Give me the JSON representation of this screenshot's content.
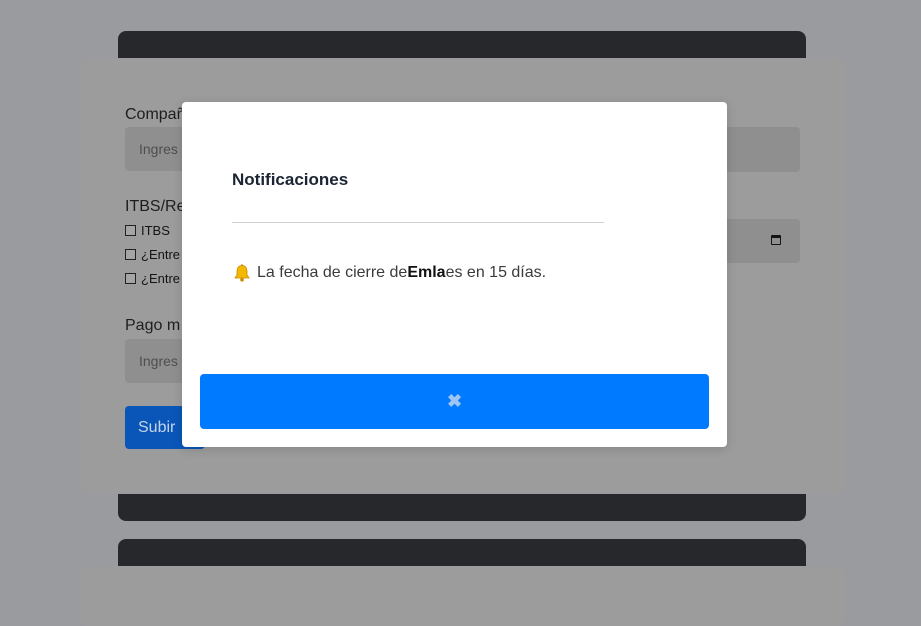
{
  "form": {
    "company_label": "Compañ",
    "company_placeholder": "Ingres",
    "itbs_label": "ITBS/Re",
    "checkbox_items": [
      "ITBS",
      "¿Entre",
      "¿Entre"
    ],
    "payment_label": "Pago m",
    "payment_placeholder": "Ingres",
    "submit_label": "Subir"
  },
  "modal": {
    "title": "Notificaciones",
    "message_prefix": "La fecha de cierre de ",
    "company_name": "Emla",
    "message_suffix": " es en 15 días.",
    "close_symbol": "✖",
    "icon": "bell-icon"
  },
  "colors": {
    "overlay_background": "#9a9b9e",
    "primary_button": "#007bff",
    "dark_card": "#26282b"
  }
}
